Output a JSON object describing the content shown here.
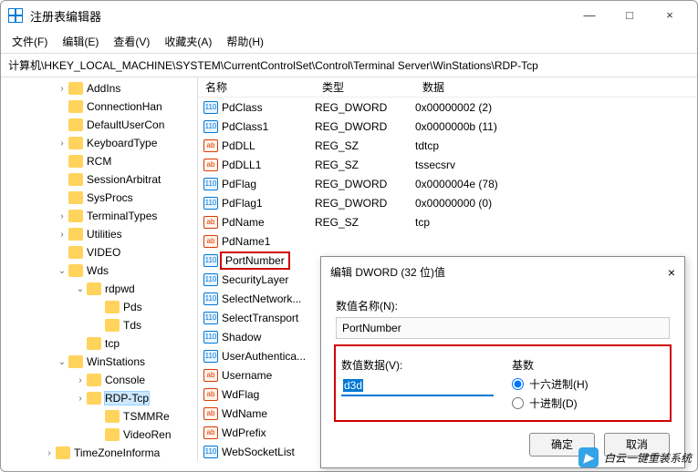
{
  "window": {
    "title": "注册表编辑器"
  },
  "winbtns": {
    "min": "—",
    "max": "□",
    "close": "×"
  },
  "menu": {
    "file": "文件(F)",
    "edit": "编辑(E)",
    "view": "查看(V)",
    "fav": "收藏夹(A)",
    "help": "帮助(H)"
  },
  "address": "计算机\\HKEY_LOCAL_MACHINE\\SYSTEM\\CurrentControlSet\\Control\\Terminal Server\\WinStations\\RDP-Tcp",
  "tree": [
    {
      "pad": 60,
      "chev": ">",
      "label": "AddIns"
    },
    {
      "pad": 60,
      "chev": "",
      "label": "ConnectionHan"
    },
    {
      "pad": 60,
      "chev": "",
      "label": "DefaultUserCon"
    },
    {
      "pad": 60,
      "chev": ">",
      "label": "KeyboardType"
    },
    {
      "pad": 60,
      "chev": "",
      "label": "RCM"
    },
    {
      "pad": 60,
      "chev": "",
      "label": "SessionArbitrat"
    },
    {
      "pad": 60,
      "chev": "",
      "label": "SysProcs"
    },
    {
      "pad": 60,
      "chev": ">",
      "label": "TerminalTypes"
    },
    {
      "pad": 60,
      "chev": ">",
      "label": "Utilities"
    },
    {
      "pad": 60,
      "chev": "",
      "label": "VIDEO"
    },
    {
      "pad": 60,
      "chev": "v",
      "label": "Wds"
    },
    {
      "pad": 80,
      "chev": "v",
      "label": "rdpwd"
    },
    {
      "pad": 100,
      "chev": "",
      "label": "Pds"
    },
    {
      "pad": 100,
      "chev": "",
      "label": "Tds"
    },
    {
      "pad": 80,
      "chev": "",
      "label": "tcp"
    },
    {
      "pad": 60,
      "chev": "v",
      "label": "WinStations"
    },
    {
      "pad": 80,
      "chev": ">",
      "label": "Console"
    },
    {
      "pad": 80,
      "chev": ">",
      "label": "RDP-Tcp",
      "sel": true
    },
    {
      "pad": 100,
      "chev": "",
      "label": "TSMMRe"
    },
    {
      "pad": 100,
      "chev": "",
      "label": "VideoRen"
    },
    {
      "pad": 46,
      "chev": ">",
      "label": "TimeZoneInforma"
    }
  ],
  "list": {
    "hdr": {
      "name": "名称",
      "type": "类型",
      "data": "数据"
    },
    "rows": [
      {
        "ico": "dw",
        "name": "PdClass",
        "type": "REG_DWORD",
        "data": "0x00000002 (2)"
      },
      {
        "ico": "dw",
        "name": "PdClass1",
        "type": "REG_DWORD",
        "data": "0x0000000b (11)"
      },
      {
        "ico": "sz",
        "name": "PdDLL",
        "type": "REG_SZ",
        "data": "tdtcp"
      },
      {
        "ico": "sz",
        "name": "PdDLL1",
        "type": "REG_SZ",
        "data": "tssecsrv"
      },
      {
        "ico": "dw",
        "name": "PdFlag",
        "type": "REG_DWORD",
        "data": "0x0000004e (78)"
      },
      {
        "ico": "dw",
        "name": "PdFlag1",
        "type": "REG_DWORD",
        "data": "0x00000000 (0)"
      },
      {
        "ico": "sz",
        "name": "PdName",
        "type": "REG_SZ",
        "data": "tcp"
      },
      {
        "ico": "sz",
        "name": "PdName1",
        "type": "",
        "data": ""
      },
      {
        "ico": "dw",
        "name": "PortNumber",
        "type": "",
        "data": "",
        "hl": true
      },
      {
        "ico": "dw",
        "name": "SecurityLayer",
        "type": "",
        "data": ""
      },
      {
        "ico": "dw",
        "name": "SelectNetwork...",
        "type": "",
        "data": ""
      },
      {
        "ico": "dw",
        "name": "SelectTransport",
        "type": "",
        "data": ""
      },
      {
        "ico": "dw",
        "name": "Shadow",
        "type": "",
        "data": ""
      },
      {
        "ico": "dw",
        "name": "UserAuthentica...",
        "type": "",
        "data": ""
      },
      {
        "ico": "sz",
        "name": "Username",
        "type": "",
        "data": ""
      },
      {
        "ico": "sz",
        "name": "WdFlag",
        "type": "",
        "data": ""
      },
      {
        "ico": "sz",
        "name": "WdName",
        "type": "",
        "data": ""
      },
      {
        "ico": "sz",
        "name": "WdPrefix",
        "type": "",
        "data": ""
      },
      {
        "ico": "dw",
        "name": "WebSocketList",
        "type": "",
        "data": ""
      }
    ]
  },
  "dialog": {
    "title": "编辑 DWORD (32 位)值",
    "close": "×",
    "name_label": "数值名称(N):",
    "name_value": "PortNumber",
    "data_label": "数值数据(V):",
    "data_value": "d3d",
    "base_label": "基数",
    "radio_hex": "十六进制(H)",
    "radio_dec": "十进制(D)",
    "ok": "确定",
    "cancel": "取消"
  },
  "watermark": {
    "text": "白云一键重装系统",
    "icon": "▶"
  }
}
